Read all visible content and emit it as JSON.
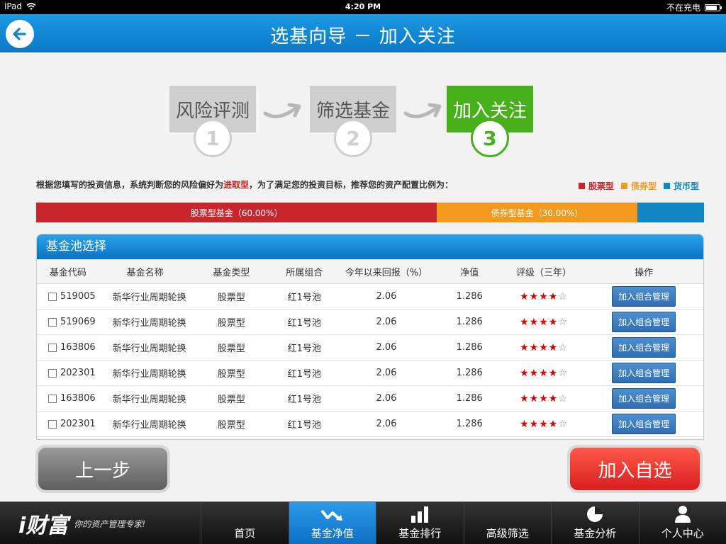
{
  "status": {
    "device": "iPad",
    "time": "4:20 PM",
    "charging": "不在充电"
  },
  "header": {
    "title": "选基向导 － 加入关注"
  },
  "steps": [
    {
      "label": "风险评测",
      "num": "1",
      "state": "done"
    },
    {
      "label": "筛选基金",
      "num": "2",
      "state": "done"
    },
    {
      "label": "加入关注",
      "num": "3",
      "state": "active"
    }
  ],
  "info": {
    "prefix": "根据您填写的投资信息，系统判断您的风险偏好为",
    "risk_type": "进取型",
    "suffix": "，为了满足您的投资目标，推荐您的资产配置比例为："
  },
  "legend": [
    {
      "label": "股票型",
      "color": "#c9252d"
    },
    {
      "label": "债券型",
      "color": "#f39a1e"
    },
    {
      "label": "货币型",
      "color": "#1186c0"
    }
  ],
  "allocation": [
    {
      "label": "股票型基金（60.00%）",
      "percent": 60.0,
      "color": "#c9252d"
    },
    {
      "label": "债券型基金（30.00%）",
      "percent": 30.0,
      "color": "#f39a1e"
    },
    {
      "label": "",
      "percent": 10.0,
      "color": "#1186c0"
    }
  ],
  "pool": {
    "title": "基金池选择",
    "columns": [
      "基金代码",
      "基金名称",
      "基金类型",
      "所属组合",
      "今年以来回报（%）",
      "净值",
      "评级（三年）",
      "操作"
    ],
    "rows": [
      {
        "code": "519005",
        "name": "新华行业周期轮换",
        "type": "股票型",
        "group": "红1号池",
        "ytd": "2.06",
        "nav": "1.286",
        "rating": 4,
        "action": "加入组合管理"
      },
      {
        "code": "519069",
        "name": "新华行业周期轮换",
        "type": "股票型",
        "group": "红1号池",
        "ytd": "2.06",
        "nav": "1.286",
        "rating": 4,
        "action": "加入组合管理"
      },
      {
        "code": "163806",
        "name": "新华行业周期轮换",
        "type": "股票型",
        "group": "红1号池",
        "ytd": "2.06",
        "nav": "1.286",
        "rating": 4,
        "action": "加入组合管理"
      },
      {
        "code": "202301",
        "name": "新华行业周期轮换",
        "type": "股票型",
        "group": "红1号池",
        "ytd": "2.06",
        "nav": "1.286",
        "rating": 4,
        "action": "加入组合管理"
      },
      {
        "code": "163806",
        "name": "新华行业周期轮换",
        "type": "股票型",
        "group": "红1号池",
        "ytd": "2.06",
        "nav": "1.286",
        "rating": 4,
        "action": "加入组合管理"
      },
      {
        "code": "202301",
        "name": "新华行业周期轮换",
        "type": "股票型",
        "group": "红1号池",
        "ytd": "2.06",
        "nav": "1.286",
        "rating": 4,
        "action": "加入组合管理"
      }
    ]
  },
  "buttons": {
    "prev": "上一步",
    "add": "加入自选"
  },
  "brand": {
    "logo": "i财富",
    "slogan": "你的资产管理专家!"
  },
  "tabs": [
    {
      "label": "首页",
      "icon": "home-icon",
      "active": false
    },
    {
      "label": "基金净值",
      "icon": "trend-icon",
      "active": true
    },
    {
      "label": "基金排行",
      "icon": "bar-chart-icon",
      "active": false
    },
    {
      "label": "高级筛选",
      "icon": "filter-icon",
      "active": false
    },
    {
      "label": "基金分析",
      "icon": "pie-chart-icon",
      "active": false
    },
    {
      "label": "个人中心",
      "icon": "user-icon",
      "active": false
    }
  ]
}
